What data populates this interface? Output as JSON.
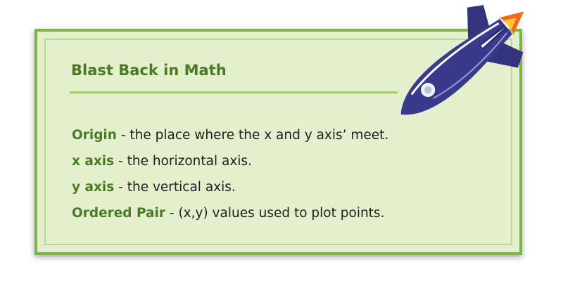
{
  "slide": {
    "title": "Blast Back in Math",
    "definitions": [
      {
        "term": "Origin",
        "separator": " - ",
        "text": "the place where the x and y axis’ meet."
      },
      {
        "term": "x axis",
        "separator": " - ",
        "text": "the horizontal axis."
      },
      {
        "term": "y axis",
        "separator": " - ",
        "text": "the vertical axis."
      },
      {
        "term": "Ordered Pair",
        "separator": " - ",
        "text": "(x,y) values used to plot points."
      }
    ]
  },
  "decoration": {
    "icon": "rocket-icon"
  },
  "colors": {
    "card_background": "#e4efcd",
    "card_border": "#7cb642",
    "accent_text": "#4b7a24",
    "rocket_body": "#3a3a8c",
    "rocket_flame": "#f26b1d"
  }
}
